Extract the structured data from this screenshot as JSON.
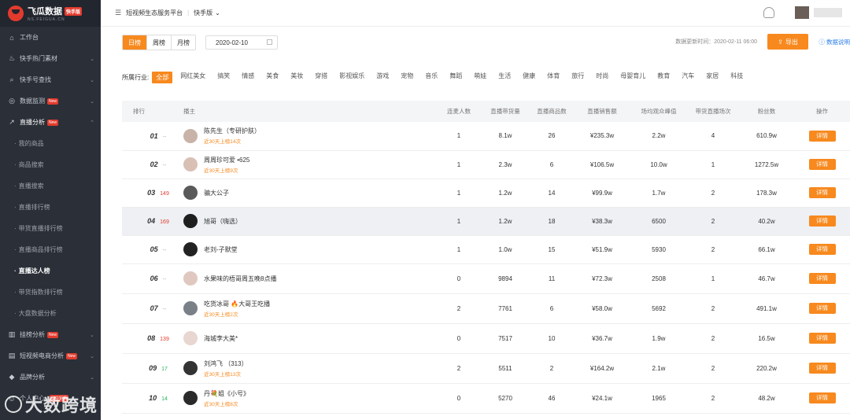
{
  "brand": {
    "name": "飞瓜数据",
    "badge": "快手版",
    "domain": "NS.FEIGUA.CN"
  },
  "sidebar": {
    "items": [
      {
        "label": "工作台",
        "icon": "home-icon",
        "ic": "⌂"
      },
      {
        "label": "快手热门素材",
        "icon": "flame-icon",
        "ic": "♨"
      },
      {
        "label": "快手号查找",
        "icon": "search-icon",
        "ic": "⌕"
      },
      {
        "label": "数据监测",
        "icon": "monitor-icon",
        "ic": "◎",
        "new": "New"
      },
      {
        "label": "直播分析",
        "icon": "trend-icon",
        "ic": "↗",
        "new": "New"
      }
    ],
    "sub": [
      "我的商品",
      "商品搜索",
      "直播搜索",
      "直播排行榜",
      "带货直播排行榜",
      "直播商品排行榜",
      "直播达人榜",
      "带货指数排行榜",
      "大盘数据分析"
    ],
    "items2": [
      {
        "label": "挂榜分析",
        "icon": "bar-chart-icon",
        "ic": "▥",
        "new": "New"
      },
      {
        "label": "短视频电商分析",
        "icon": "cart-icon",
        "ic": "▤",
        "new": "New"
      },
      {
        "label": "品牌分析",
        "icon": "diamond-icon",
        "ic": "◆"
      }
    ],
    "bottom_label": "个人中心",
    "bottom_badge": "年中钜惠",
    "watermark": "大数跨境"
  },
  "topbar": {
    "platform": "短视频生态服务平台",
    "version": "快手版"
  },
  "controls": {
    "tabs": [
      "日榜",
      "周榜",
      "月榜"
    ],
    "date": "2020-02-10",
    "update": "数据更新时间：2020-02-11 06:00",
    "export": "导出",
    "help": "数据说明"
  },
  "industries": {
    "label": "所属行业:",
    "items": [
      "全部",
      "网红美女",
      "搞笑",
      "情感",
      "美食",
      "美妆",
      "穿搭",
      "影视娱乐",
      "游戏",
      "宠物",
      "音乐",
      "舞蹈",
      "萌娃",
      "生活",
      "健康",
      "体育",
      "旅行",
      "时尚",
      "母婴育儿",
      "教育",
      "汽车",
      "家居",
      "科技"
    ]
  },
  "table": {
    "headers": [
      "排行",
      "播主",
      "连麦人数",
      "直播带货量",
      "直播商品数",
      "直播销售额",
      "场均观众峰值",
      "带货直播场次",
      "粉丝数",
      "操作"
    ],
    "action_label": "详情",
    "rows": [
      {
        "rank": "01",
        "change": "--",
        "ctype": "same",
        "name": "陈先生（专研护肤）",
        "tag": "近30天上榜14次",
        "av": "#c9b3a8",
        "mic": "1",
        "sales": "8.1w",
        "goods": "26",
        "gmv": "¥235.3w",
        "peak": "2.2w",
        "sessions": "4",
        "fans": "610.9w"
      },
      {
        "rank": "02",
        "change": "--",
        "ctype": "same",
        "name": "周周珍可爱 •625",
        "tag": "近30天上榜9次",
        "av": "#d9c0b5",
        "mic": "1",
        "sales": "2.3w",
        "goods": "6",
        "gmv": "¥106.5w",
        "peak": "10.0w",
        "sessions": "1",
        "fans": "1272.5w"
      },
      {
        "rank": "03",
        "change": "149",
        "ctype": "down",
        "name": "骗大公子",
        "tag": "",
        "av": "#5a5a5a",
        "mic": "1",
        "sales": "1.2w",
        "goods": "14",
        "gmv": "¥99.9w",
        "peak": "1.7w",
        "sessions": "2",
        "fans": "178.3w"
      },
      {
        "rank": "04",
        "change": "169",
        "ctype": "down",
        "name": "旭哥（嗨选）",
        "tag": "",
        "av": "#1e1e1e",
        "mic": "1",
        "sales": "1.2w",
        "goods": "18",
        "gmv": "¥38.3w",
        "peak": "6500",
        "sessions": "2",
        "fans": "40.2w",
        "hl": true
      },
      {
        "rank": "05",
        "change": "--",
        "ctype": "same",
        "name": "老刘-子默堂",
        "tag": "",
        "av": "#222",
        "mic": "1",
        "sales": "1.0w",
        "goods": "15",
        "gmv": "¥51.9w",
        "peak": "5930",
        "sessions": "2",
        "fans": "66.1w"
      },
      {
        "rank": "06",
        "change": "--",
        "ctype": "same",
        "name": "水果味的梧哥周五晚8点播",
        "tag": "",
        "av": "#e0c8c0",
        "mic": "0",
        "sales": "9894",
        "goods": "11",
        "gmv": "¥72.3w",
        "peak": "2508",
        "sessions": "1",
        "fans": "46.7w"
      },
      {
        "rank": "07",
        "change": "--",
        "ctype": "same",
        "name": "吃货冰哥 🔥大哥王吃播",
        "tag": "近30天上榜2次",
        "av": "#7a8088",
        "mic": "2",
        "sales": "7761",
        "goods": "6",
        "gmv": "¥58.0w",
        "peak": "5692",
        "sessions": "2",
        "fans": "491.1w"
      },
      {
        "rank": "08",
        "change": "139",
        "ctype": "down",
        "name": "海城李大美*",
        "tag": "",
        "av": "#e8d6d0",
        "mic": "0",
        "sales": "7517",
        "goods": "10",
        "gmv": "¥36.7w",
        "peak": "1.9w",
        "sessions": "2",
        "fans": "16.5w"
      },
      {
        "rank": "09",
        "change": "17",
        "ctype": "up",
        "name": "刘鸿飞 （313）",
        "tag": "近30天上榜13次",
        "av": "#333",
        "mic": "2",
        "sales": "5511",
        "goods": "2",
        "gmv": "¥164.2w",
        "peak": "2.1w",
        "sessions": "2",
        "fans": "220.2w"
      },
      {
        "rank": "10",
        "change": "14",
        "ctype": "up",
        "name": "丹💐姐《小号》",
        "tag": "近30天上榜8次",
        "av": "#2a2a2a",
        "mic": "0",
        "sales": "5270",
        "goods": "46",
        "gmv": "¥24.1w",
        "peak": "1965",
        "sessions": "2",
        "fans": "48.2w"
      }
    ]
  }
}
